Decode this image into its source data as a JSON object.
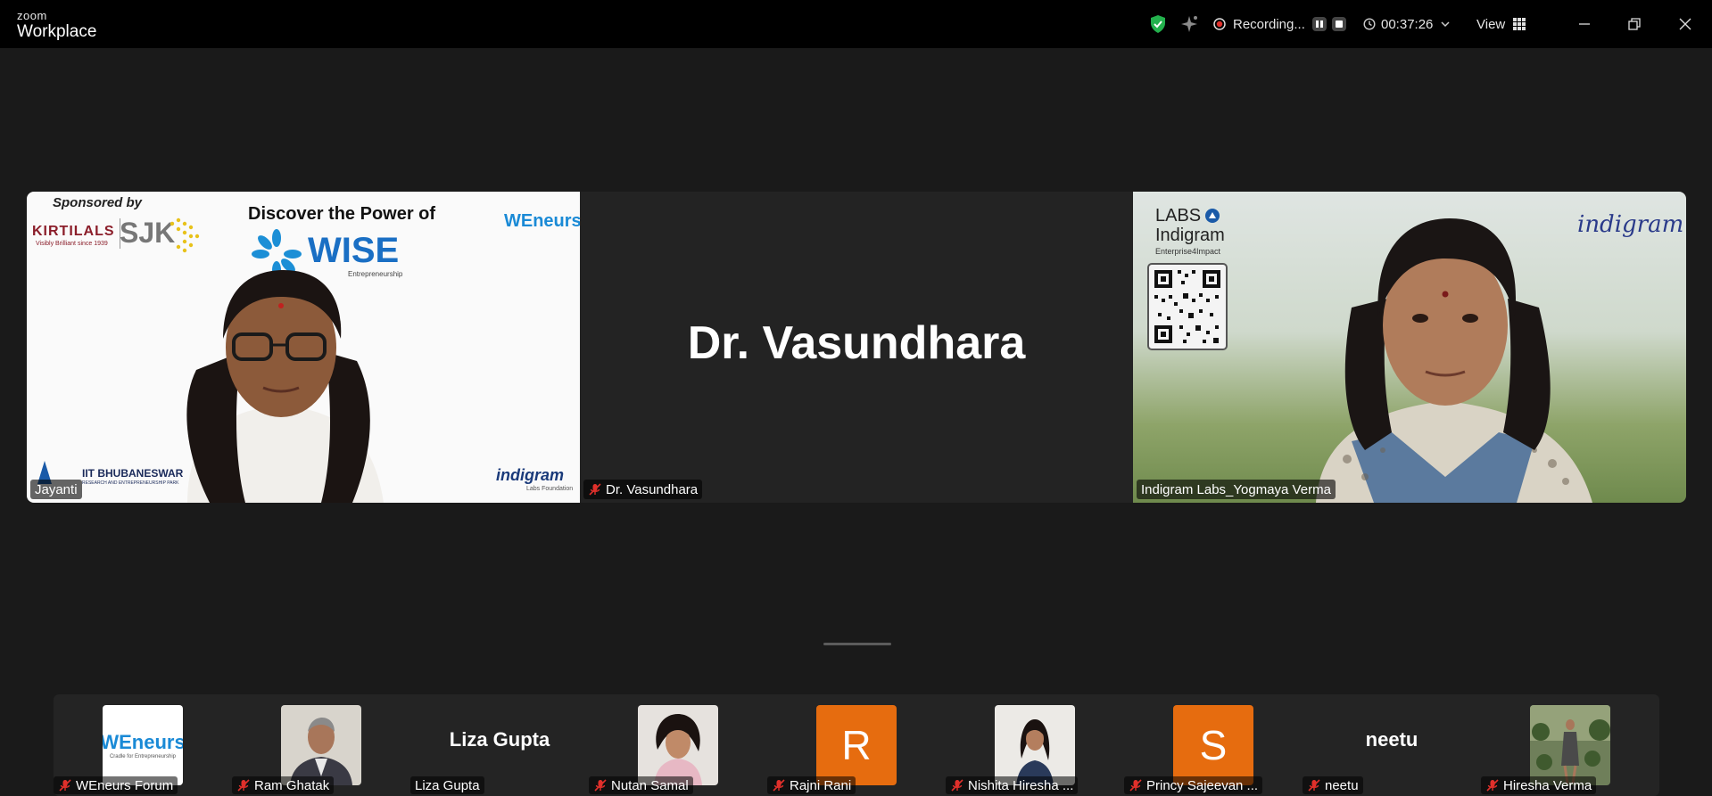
{
  "app": {
    "brand_small": "zoom",
    "brand_big": "Workplace"
  },
  "toolbar": {
    "recording_label": "Recording...",
    "timer": "00:37:26",
    "view_label": "View"
  },
  "main_tiles": [
    {
      "name": "Jayanti",
      "muted": false,
      "slide": {
        "sponsored": "Sponsored by",
        "sponsor1": "KIRTILALS",
        "sponsor1_tag": "Visibly Brilliant since 1939",
        "sponsor2": "SJK",
        "headline": "Discover the Power of",
        "wise": "WISE",
        "wise_sub": "Entrepreneurship",
        "weneurs": "WEneurs",
        "iit": "IIT BHUBANESWAR",
        "iit_sub": "RESEARCH AND ENTREPRENEURSHIP PARK",
        "indigram": "indigram",
        "indigram_sub": "Labs Foundation"
      }
    },
    {
      "name": "Dr. Vasundhara",
      "display_name": "Dr. Vasundhara",
      "muted": true
    },
    {
      "name": "Indigram Labs_Yogmaya Verma",
      "muted": false,
      "bg": {
        "labs": "LABS",
        "indigram": "Indigram",
        "enterprise": "Enterprise4Impact",
        "logo": "indigram"
      }
    }
  ],
  "participants": [
    {
      "name": "WEneurs Forum",
      "muted": true,
      "type": "logo",
      "logo_text": "WEneurs",
      "logo_sub": "Cradle for Entrepreneurship"
    },
    {
      "name": "Ram Ghatak",
      "muted": true,
      "type": "photo"
    },
    {
      "name": "Liza Gupta",
      "muted": false,
      "type": "name",
      "display": "Liza Gupta"
    },
    {
      "name": "Nutan Samal",
      "muted": true,
      "type": "photo"
    },
    {
      "name": "Rajni Rani",
      "muted": true,
      "type": "letter",
      "letter": "R"
    },
    {
      "name": "Nishita Hiresha ...",
      "muted": true,
      "type": "photo"
    },
    {
      "name": "Princy Sajeevan ...",
      "muted": true,
      "type": "letter",
      "letter": "S"
    },
    {
      "name": "neetu",
      "muted": true,
      "type": "name",
      "display": "neetu"
    },
    {
      "name": "Hiresha Verma",
      "muted": true,
      "type": "photo"
    }
  ],
  "colors": {
    "accent_orange": "#e66c0f",
    "mute_red": "#e0302b",
    "shield_green": "#23b14d"
  }
}
